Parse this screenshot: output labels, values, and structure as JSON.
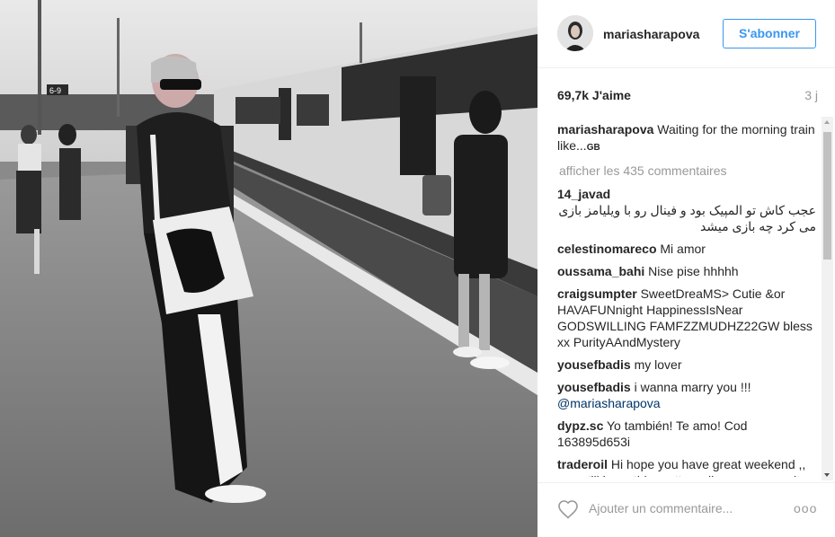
{
  "post": {
    "photo": {
      "alt_text": "",
      "platform_sign": "6-9"
    }
  },
  "header": {
    "username": "mariasharapova",
    "follow_label": "S'abonner"
  },
  "stats": {
    "likes": "69,7k J'aime",
    "time": "3 j"
  },
  "caption": {
    "username": "mariasharapova",
    "text": "Waiting for the morning train like...",
    "suffix": "GB"
  },
  "view_all": "afficher les 435 commentaires",
  "comments": [
    {
      "user": "14_javad",
      "text": "عجب کاش تو المپیک بود و فینال رو با ویلیامز بازی می کرد چه بازی میشد",
      "rtl": true
    },
    {
      "user": "celestinomareco",
      "text": "Mi amor"
    },
    {
      "user": "oussama_bahi",
      "text": "Nise pise hhhhh"
    },
    {
      "user": "craigsumpter",
      "text": "SweetDreaMS> Cutie &or HAVAFUNnight HappinessIsNear GODSWILLING FAMFZZMUDHZ22GW bless xx PurityAAndMystery"
    },
    {
      "user": "yousefbadis",
      "text": "my lover"
    },
    {
      "user": "yousefbadis",
      "text": "i wanna marry you !!!",
      "mention": "@mariasharapova"
    },
    {
      "user": "dypz.sc",
      "text": "Yo también! Te amo! Cod 163895d653i"
    },
    {
      "user": "traderoil",
      "text": "Hi hope you have great weekend ,, you still have this pretty smile or you grow it face I think so!!"
    }
  ],
  "footer": {
    "add_comment_placeholder": "Ajouter un commentaire...",
    "more_options": "ooo"
  },
  "colors": {
    "accent": "#3897f0",
    "text": "#262626",
    "muted": "#999999",
    "mention": "#003569"
  }
}
